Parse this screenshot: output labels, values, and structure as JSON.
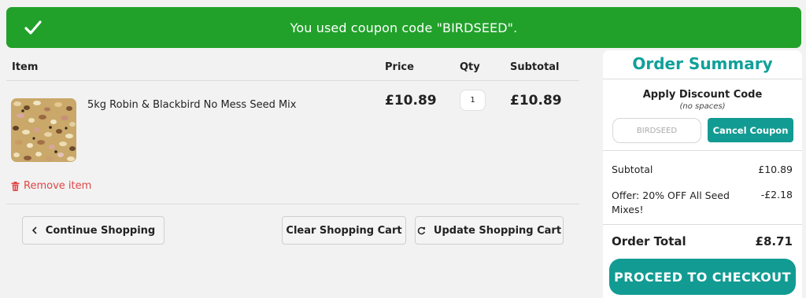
{
  "banner": {
    "message": "You used coupon code \"BIRDSEED\".",
    "icon": "check-icon",
    "color": "#21a12a"
  },
  "cart": {
    "headers": {
      "item": "Item",
      "price": "Price",
      "qty": "Qty",
      "subtotal": "Subtotal"
    },
    "items": [
      {
        "name": "5kg Robin & Blackbird No Mess Seed Mix",
        "price": "£10.89",
        "qty": "1",
        "subtotal": "£10.89",
        "image": "seed-mix-photo"
      }
    ],
    "remove_label": "Remove item",
    "buttons": {
      "continue": "Continue Shopping",
      "clear": "Clear Shopping Cart",
      "update": "Update Shopping Cart"
    }
  },
  "summary": {
    "title": "Order Summary",
    "discount_label": "Apply Discount Code",
    "discount_hint": "(no spaces)",
    "coupon_value": "BIRDSEED",
    "cancel_coupon": "Cancel Coupon",
    "subtotal_label": "Subtotal",
    "subtotal_value": "£10.89",
    "offer_label": "Offer: 20% OFF All Seed Mixes!",
    "offer_value": "-£2.18",
    "total_label": "Order Total",
    "total_value": "£8.71",
    "checkout": "PROCEED TO CHECKOUT",
    "accent": "#129b93"
  },
  "colors": {
    "remove": "#e04646",
    "teal": "#10a09a"
  }
}
